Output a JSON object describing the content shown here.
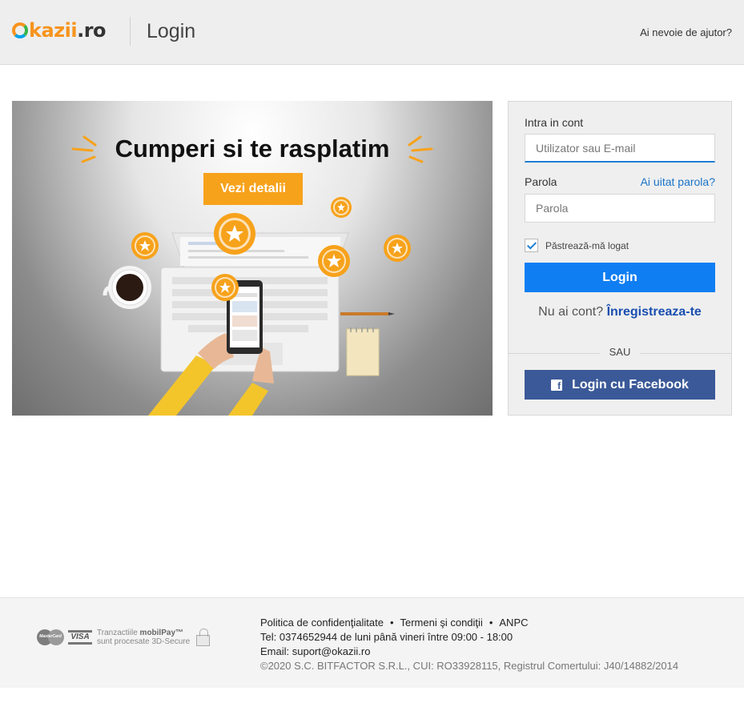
{
  "header": {
    "logo_text": "Okazii.ro",
    "logo_kazii": "kazii",
    "logo_ro": ".ro",
    "page_title": "Login",
    "help_link": "Ai nevoie de ajutor?"
  },
  "banner": {
    "title": "Cumperi si te rasplatim",
    "button_label": "Vezi detalii"
  },
  "login_form": {
    "section_title": "Intra in cont",
    "username_placeholder": "Utilizator sau E-mail",
    "password_label": "Parola",
    "forgot_link": "Ai uitat parola?",
    "password_placeholder": "Parola",
    "remember_label": "Păstrează-mă logat",
    "remember_checked": true,
    "login_button": "Login",
    "register_prompt": "Nu ai cont?",
    "register_link": "Înregistreaza-te",
    "separator": "SAU",
    "facebook_button": "Login cu Facebook"
  },
  "footer": {
    "payment": {
      "mastercard": "MasterCard",
      "visa": "VISA",
      "mobilpay_line1_prefix": "Tranzactiile ",
      "mobilpay_line1_brand": "mobilPay™",
      "mobilpay_line2": "sunt procesate 3D-Secure"
    },
    "links": [
      "Politica de confidenţialitate",
      "Termeni şi condiţii",
      "ANPC"
    ],
    "phone": "Tel: 0374652944 de luni până vineri între 09:00 - 18:00",
    "email": "Email: suport@okazii.ro",
    "copyright": "©2020 S.C. BITFACTOR S.R.L., CUI: RO33928115, Registrul Comertului: J40/14882/2014"
  },
  "colors": {
    "brand_orange": "#f7941d",
    "login_blue": "#0f7ef2",
    "facebook_blue": "#3b5998",
    "link_blue": "#1a73c8"
  },
  "icons": [
    "logo-o-icon",
    "check-icon",
    "facebook-icon",
    "lock-icon",
    "star-icon",
    "coffee-cup-icon",
    "laptop-icon",
    "phone-icon",
    "notepad-icon",
    "pencil-icon"
  ]
}
